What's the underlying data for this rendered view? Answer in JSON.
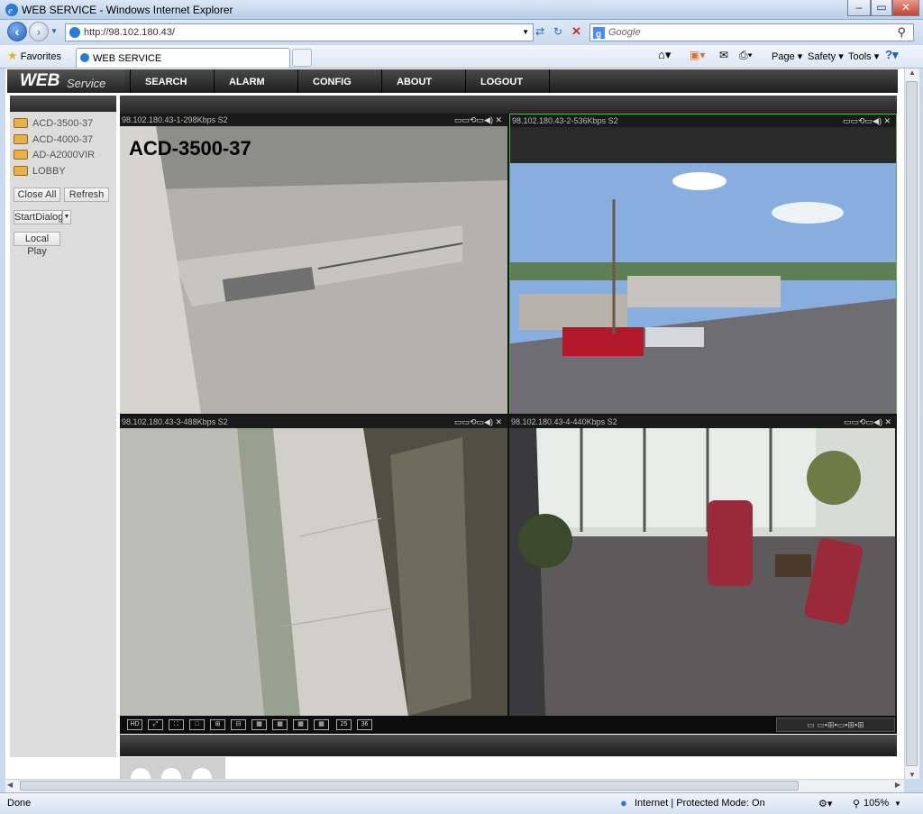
{
  "window": {
    "title": "WEB SERVICE - Windows Internet Explorer"
  },
  "address": {
    "url": "http://98.102.180.43/",
    "search_placeholder": "Google"
  },
  "favorites": {
    "label": "Favorites",
    "tab_title": "WEB SERVICE"
  },
  "commandbar": {
    "page": "Page",
    "safety": "Safety",
    "tools": "Tools"
  },
  "app": {
    "logo_main": "WEB",
    "logo_sub": "Service",
    "menu": [
      "SEARCH",
      "ALARM",
      "CONFIG",
      "ABOUT",
      "LOGOUT"
    ]
  },
  "sidebar": {
    "devices": [
      "ACD-3500-37",
      "ACD-4000-37",
      "AD-A2000VIR",
      "LOBBY"
    ],
    "close_all": "Close All",
    "refresh": "Refresh",
    "start_dialog": "StartDialog",
    "local_play": "Local Play"
  },
  "panes": [
    {
      "header": "98.102.180.43-1-298Kbps S2",
      "overlay": "ACD-3500-37"
    },
    {
      "header": "98.102.180.43-2-536Kbps S2",
      "overlay": ""
    },
    {
      "header": "98.102.180.43-3-488Kbps S2",
      "overlay": ""
    },
    {
      "header": "98.102.180.43-4-440Kbps S2",
      "overlay": ""
    }
  ],
  "toolbar": {
    "split25": "25",
    "split36": "36"
  },
  "status": {
    "left": "Done",
    "zone": "Internet | Protected Mode: On",
    "zoom": "105%"
  }
}
